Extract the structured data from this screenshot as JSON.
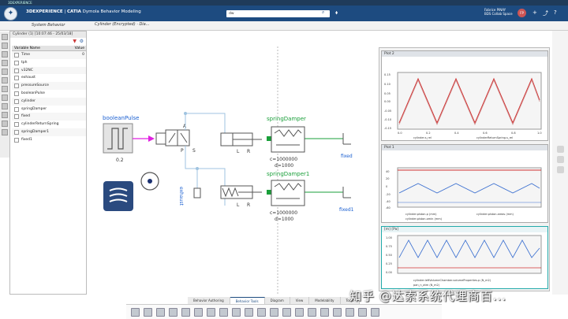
{
  "os_title": "3DEXPERIENCE",
  "header": {
    "brand_prefix": "3DEXPERIENCE",
    "brand_app": "CATIA",
    "brand_module": "Dymola Behavior Modeling",
    "search_value": "dw",
    "user_name": "Fabrice PINAY",
    "user_space": "BDS Collab Space",
    "avatar_initials": "FP"
  },
  "tabs": {
    "document": "Cylinder (Encrypted) · Dia...",
    "system_behavior": "System Behavior"
  },
  "variables_panel": {
    "title": "Cylinder (1) [10:07:46 - 25/03/18]",
    "col_name": "Variable Name",
    "col_value": "Value",
    "rows": [
      {
        "name": "Time",
        "value": "0"
      },
      {
        "name": "tph",
        "value": ""
      },
      {
        "name": "v32NC",
        "value": ""
      },
      {
        "name": "exhaust",
        "value": ""
      },
      {
        "name": "pressureSource",
        "value": ""
      },
      {
        "name": "booleanPulse",
        "value": ""
      },
      {
        "name": "cylinder",
        "value": ""
      },
      {
        "name": "springDamper",
        "value": ""
      },
      {
        "name": "fixed",
        "value": ""
      },
      {
        "name": "cylinderReturnSpring",
        "value": ""
      },
      {
        "name": "springDamper1",
        "value": ""
      },
      {
        "name": "fixed1",
        "value": ""
      }
    ]
  },
  "diagram": {
    "boolean_pulse_label": "booleanPulse",
    "boolean_pulse_value": "0.2",
    "valve_A": "A",
    "valve_P": "P",
    "valve_S": "S",
    "exhaust_label": "exhaust",
    "L1": "L",
    "R1": "R",
    "L2": "L",
    "R2": "R",
    "spring1_label": "springDamper",
    "spring1_c": "c=1000000",
    "spring1_d": "d=1000",
    "spring2_label": "springDamper1",
    "spring2_c": "c=1000000",
    "spring2_d": "d=1000",
    "fixed_label": "fixed",
    "fixed1_label": "fixed1"
  },
  "plots": {
    "plot1_title": "Plot 2",
    "plot1_y": [
      "0.15",
      "0.10",
      "0.05",
      "0.00",
      "-0.05",
      "-0.10",
      "-0.15"
    ],
    "plot1_x": [
      "0.0",
      "0.2",
      "0.4",
      "0.6",
      "0.8",
      "1.0"
    ],
    "plot1_legend1": "cylinder.s_rel",
    "plot1_legend2": "cylinderReturnSpring.s_rel",
    "plot2_title": "Plot 1",
    "plot2_y": [
      "40",
      "20",
      "0",
      "-20",
      "-40",
      "-60"
    ],
    "plot2_legend1": "cylinder.piston.p (mm)",
    "plot2_legend2": "cylinder.piston.areas (mm)",
    "plot2_legend3": "cylinder.piston.omin (mm)",
    "plot3_title": "[m] [Pa]",
    "plot3_y": [
      "1.00",
      "0.75",
      "0.50",
      "0.25",
      "0.00"
    ],
    "plot3_legend1": "cylinder.leftVolumeChamber.volumeProperties.p (N_m2)",
    "plot3_legend2": "pan_n_atm (N_m2)"
  },
  "bottom_tabs": [
    "Behavior Authoring",
    "Behavior Tools",
    "Diagram",
    "View",
    "Modelability",
    "Tools"
  ],
  "active_tab": "Behavior Tools",
  "watermark": "知乎 @达索系统代理商百...",
  "colors": {
    "header": "#1d4b80",
    "diagram_blue": "#1a5fd1",
    "diagram_green": "#1a9f3a",
    "signal_magenta": "#e020e0",
    "plot_red": "#d03030",
    "plot_blue": "#3a6fd0"
  }
}
